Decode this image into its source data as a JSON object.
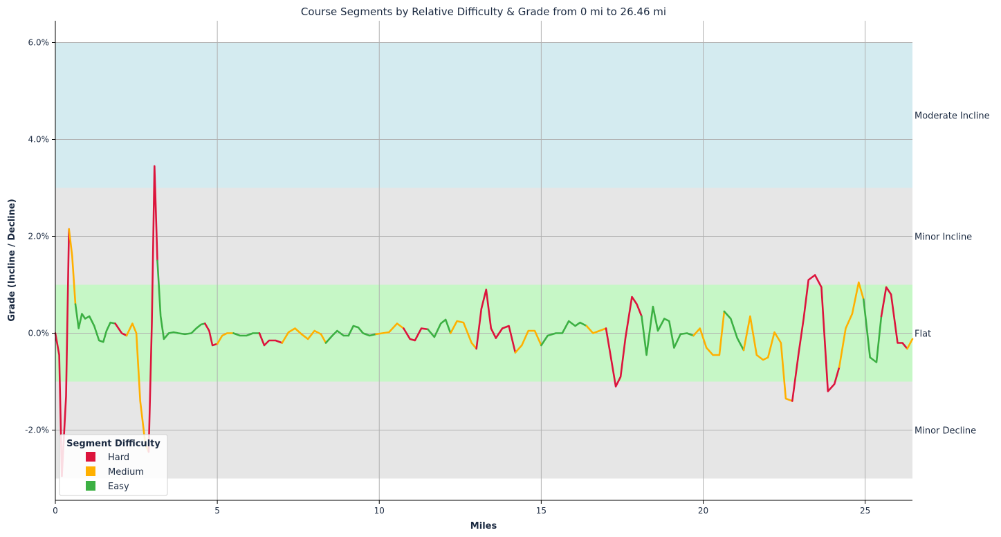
{
  "chart_data": {
    "type": "line",
    "title": "Course Segments by Relative Difficulty & Grade from 0 mi to 26.46 mi",
    "xlabel": "Miles",
    "ylabel": "Grade (Incline / Decline)",
    "xlim": [
      0,
      26.46
    ],
    "ylim": [
      -3.45,
      6.45
    ],
    "x_ticks": [
      0,
      5,
      10,
      15,
      20,
      25
    ],
    "x_tick_labels": [
      "0",
      "5",
      "10",
      "15",
      "20",
      "25"
    ],
    "y_ticks": [
      -2,
      0,
      2,
      4,
      6
    ],
    "y_tick_labels": [
      "-2.0%",
      "0.0%",
      "2.0%",
      "4.0%",
      "6.0%"
    ],
    "grid": true,
    "legend_position": "bottom-left",
    "legend": {
      "title": "Segment Difficulty",
      "entries": [
        {
          "label": "Hard",
          "color": "#dc143c"
        },
        {
          "label": "Medium",
          "color": "#ffb000"
        },
        {
          "label": "Easy",
          "color": "#3cb043"
        }
      ]
    },
    "bands": [
      {
        "label": "Moderate Incline",
        "ymin": 3,
        "ymax": 6,
        "color": "#d4ebf0",
        "label_y": 4.5
      },
      {
        "label": "Minor Incline",
        "ymin": 1,
        "ymax": 3,
        "color": "#e6e6e6",
        "label_y": 2
      },
      {
        "label": "Flat",
        "ymin": -1,
        "ymax": 1,
        "color": "#c6f7c6",
        "label_y": 0
      },
      {
        "label": "Minor Decline",
        "ymin": -3,
        "ymax": -1,
        "color": "#e6e6e6",
        "label_y": -2
      }
    ],
    "series": [
      {
        "x": [
          0,
          0.12,
          0.2
        ],
        "values": [
          0,
          -0.45,
          -2.95
        ],
        "color": "#dc143c"
      },
      {
        "x": [
          0.2,
          0.33,
          0.42
        ],
        "values": [
          -2.95,
          -1.3,
          2.15
        ],
        "color": "#dc143c"
      },
      {
        "x": [
          0.42,
          0.52,
          0.62
        ],
        "values": [
          2.15,
          1.6,
          0.6
        ],
        "color": "#ffb000"
      },
      {
        "x": [
          0.62,
          0.72,
          0.82,
          0.92,
          1.05,
          1.2,
          1.35,
          1.48,
          1.58,
          1.7,
          1.85
        ],
        "values": [
          0.6,
          0.1,
          0.4,
          0.3,
          0.35,
          0.15,
          -0.15,
          -0.18,
          0.05,
          0.22,
          0.2
        ],
        "color": "#3cb043"
      },
      {
        "x": [
          1.85,
          2.05,
          2.2
        ],
        "values": [
          0.2,
          0.0,
          -0.05
        ],
        "color": "#dc143c"
      },
      {
        "x": [
          2.2,
          2.38,
          2.5,
          2.62,
          2.78,
          2.88
        ],
        "values": [
          -0.05,
          0.2,
          0.0,
          -1.4,
          -2.3,
          -2.45
        ],
        "color": "#ffb000"
      },
      {
        "x": [
          2.88,
          2.98,
          3.06,
          3.15
        ],
        "values": [
          -2.45,
          0.2,
          3.45,
          1.5
        ],
        "color": "#dc143c"
      },
      {
        "x": [
          3.15,
          3.25,
          3.35,
          3.5,
          3.65,
          3.8,
          4.0,
          4.2,
          4.35,
          4.5,
          4.62
        ],
        "values": [
          1.5,
          0.35,
          -0.12,
          0.0,
          0.02,
          0.0,
          -0.02,
          0.0,
          0.1,
          0.18,
          0.2
        ],
        "color": "#3cb043"
      },
      {
        "x": [
          4.62,
          4.75,
          4.85,
          5.0
        ],
        "values": [
          0.2,
          0.05,
          -0.25,
          -0.22
        ],
        "color": "#dc143c"
      },
      {
        "x": [
          5.0,
          5.15,
          5.3,
          5.5
        ],
        "values": [
          -0.22,
          -0.05,
          0.0,
          0.0
        ],
        "color": "#ffb000"
      },
      {
        "x": [
          5.5,
          5.7,
          5.9,
          6.1,
          6.3
        ],
        "values": [
          0.0,
          -0.05,
          -0.05,
          0.0,
          0.0
        ],
        "color": "#3cb043"
      },
      {
        "x": [
          6.3,
          6.45,
          6.6,
          6.8,
          7.0
        ],
        "values": [
          0.0,
          -0.25,
          -0.15,
          -0.15,
          -0.2
        ],
        "color": "#dc143c"
      },
      {
        "x": [
          7.0,
          7.2,
          7.4,
          7.6,
          7.8
        ],
        "values": [
          -0.2,
          0.02,
          0.1,
          -0.02,
          -0.12
        ],
        "color": "#ffb000"
      },
      {
        "x": [
          7.8,
          8.0,
          8.2,
          8.35
        ],
        "values": [
          -0.12,
          0.05,
          -0.02,
          -0.2
        ],
        "color": "#ffb000"
      },
      {
        "x": [
          8.35,
          8.55,
          8.7,
          8.9,
          9.05
        ],
        "values": [
          -0.2,
          -0.05,
          0.05,
          -0.05,
          -0.05
        ],
        "color": "#3cb043"
      },
      {
        "x": [
          9.05,
          9.2,
          9.35,
          9.5,
          9.7,
          9.9
        ],
        "values": [
          -0.05,
          0.15,
          0.12,
          0.0,
          -0.05,
          -0.02
        ],
        "color": "#3cb043"
      },
      {
        "x": [
          9.9,
          10.1,
          10.3,
          10.55,
          10.75
        ],
        "values": [
          -0.02,
          0.0,
          0.02,
          0.2,
          0.1
        ],
        "color": "#ffb000"
      },
      {
        "x": [
          10.75,
          10.95,
          11.1,
          11.3,
          11.5
        ],
        "values": [
          0.1,
          -0.12,
          -0.15,
          0.1,
          0.08
        ],
        "color": "#dc143c"
      },
      {
        "x": [
          11.5,
          11.7,
          11.9,
          12.05,
          12.2
        ],
        "values": [
          0.08,
          -0.08,
          0.2,
          0.28,
          0.0
        ],
        "color": "#3cb043"
      },
      {
        "x": [
          12.2,
          12.4,
          12.6,
          12.85,
          13.0
        ],
        "values": [
          0.0,
          0.25,
          0.22,
          -0.2,
          -0.32
        ],
        "color": "#ffb000"
      },
      {
        "x": [
          13.0,
          13.15,
          13.3,
          13.45,
          13.6
        ],
        "values": [
          -0.32,
          0.5,
          0.9,
          0.1,
          -0.1
        ],
        "color": "#dc143c"
      },
      {
        "x": [
          13.6,
          13.8,
          14.0,
          14.2
        ],
        "values": [
          -0.1,
          0.1,
          0.15,
          -0.4
        ],
        "color": "#dc143c"
      },
      {
        "x": [
          14.2,
          14.4,
          14.6,
          14.8,
          15.0
        ],
        "values": [
          -0.4,
          -0.25,
          0.05,
          0.05,
          -0.25
        ],
        "color": "#ffb000"
      },
      {
        "x": [
          15.0,
          15.2,
          15.45,
          15.65,
          15.85,
          16.05,
          16.2,
          16.4
        ],
        "values": [
          -0.25,
          -0.05,
          0.0,
          0.0,
          0.25,
          0.15,
          0.22,
          0.15
        ],
        "color": "#3cb043"
      },
      {
        "x": [
          16.4,
          16.6,
          16.8,
          17.0
        ],
        "values": [
          0.15,
          0.0,
          0.05,
          0.1
        ],
        "color": "#ffb000"
      },
      {
        "x": [
          17.0,
          17.15,
          17.3,
          17.45,
          17.6,
          17.8,
          17.95,
          18.1
        ],
        "values": [
          0.1,
          -0.5,
          -1.1,
          -0.9,
          -0.1,
          0.75,
          0.6,
          0.35
        ],
        "color": "#dc143c"
      },
      {
        "x": [
          18.1,
          18.25,
          18.45,
          18.6,
          18.8,
          18.95,
          19.1
        ],
        "values": [
          0.35,
          -0.45,
          0.55,
          0.05,
          0.3,
          0.25,
          -0.3
        ],
        "color": "#3cb043"
      },
      {
        "x": [
          19.1,
          19.3,
          19.5,
          19.7
        ],
        "values": [
          -0.3,
          -0.02,
          0.0,
          -0.05
        ],
        "color": "#3cb043"
      },
      {
        "x": [
          19.7,
          19.9,
          20.1,
          20.3,
          20.5,
          20.65
        ],
        "values": [
          -0.05,
          0.1,
          -0.3,
          -0.45,
          -0.45,
          0.45
        ],
        "color": "#ffb000"
      },
      {
        "x": [
          20.65,
          20.85,
          21.05,
          21.25
        ],
        "values": [
          0.45,
          0.3,
          -0.1,
          -0.35
        ],
        "color": "#3cb043"
      },
      {
        "x": [
          21.25,
          21.45,
          21.65,
          21.85,
          22.0
        ],
        "values": [
          -0.35,
          0.35,
          -0.45,
          -0.55,
          -0.5
        ],
        "color": "#ffb000"
      },
      {
        "x": [
          22.0,
          22.2,
          22.4,
          22.55,
          22.75
        ],
        "values": [
          -0.5,
          0.02,
          -0.2,
          -1.35,
          -1.4
        ],
        "color": "#ffb000"
      },
      {
        "x": [
          22.75,
          22.95,
          23.1,
          23.25,
          23.45
        ],
        "values": [
          -1.4,
          -0.4,
          0.3,
          1.1,
          1.2
        ],
        "color": "#dc143c"
      },
      {
        "x": [
          23.45,
          23.65,
          23.85,
          24.05,
          24.2
        ],
        "values": [
          1.2,
          0.95,
          -1.2,
          -1.05,
          -0.7
        ],
        "color": "#dc143c"
      },
      {
        "x": [
          24.2,
          24.4,
          24.6,
          24.8,
          24.95
        ],
        "values": [
          -0.7,
          0.1,
          0.4,
          1.05,
          0.7
        ],
        "color": "#ffb000"
      },
      {
        "x": [
          24.95,
          25.15,
          25.35,
          25.5
        ],
        "values": [
          0.7,
          -0.5,
          -0.6,
          0.35
        ],
        "color": "#3cb043"
      },
      {
        "x": [
          25.5,
          25.65,
          25.8,
          26.0,
          26.15,
          26.3
        ],
        "values": [
          0.35,
          0.95,
          0.8,
          -0.2,
          -0.2,
          -0.32
        ],
        "color": "#dc143c"
      },
      {
        "x": [
          26.3,
          26.46
        ],
        "values": [
          -0.32,
          -0.12
        ],
        "color": "#ffb000"
      }
    ]
  }
}
